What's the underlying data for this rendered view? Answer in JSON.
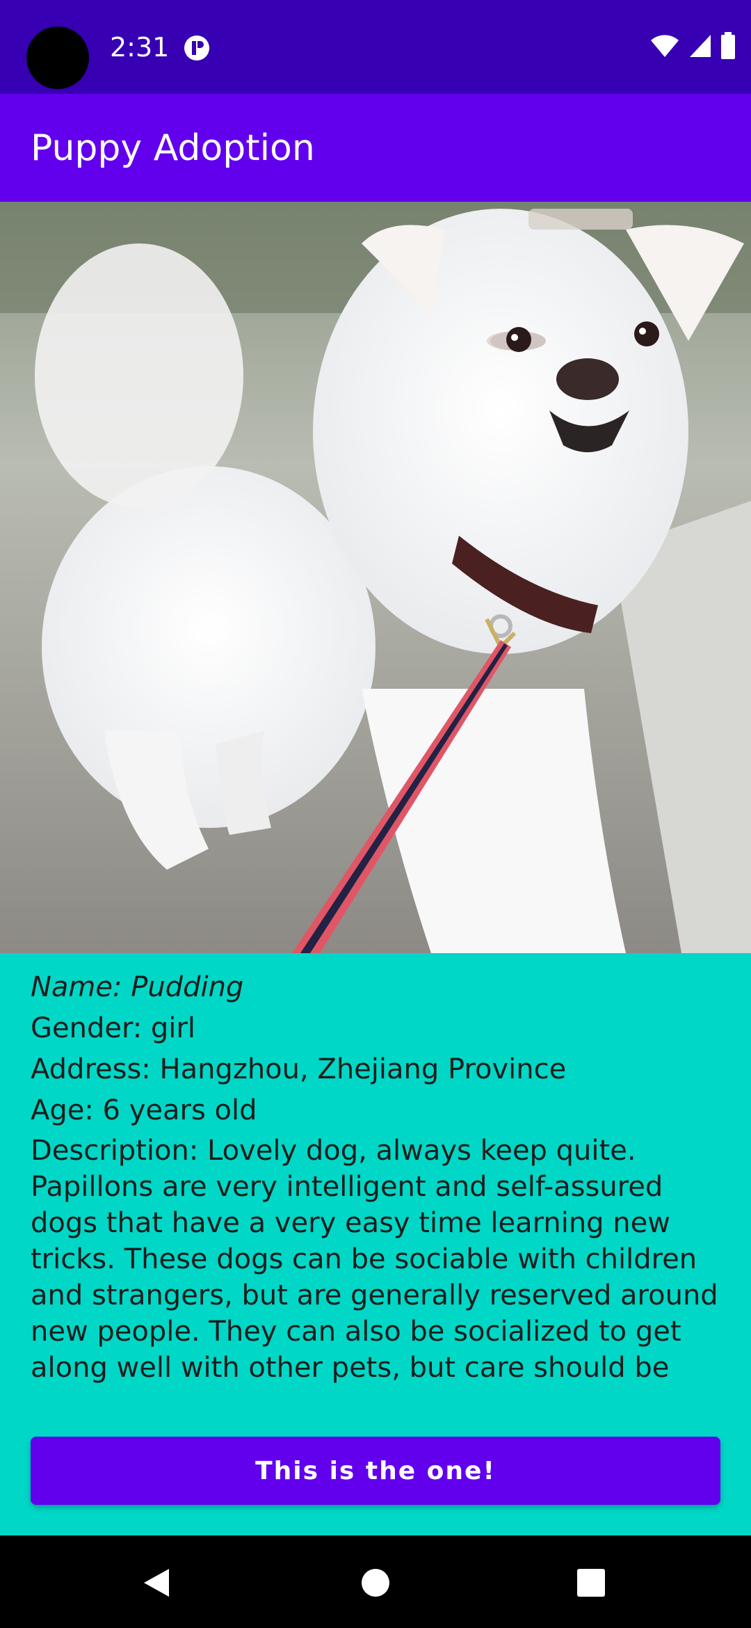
{
  "status_bar": {
    "time": "2:31",
    "icons": [
      "app-notification-icon",
      "wifi-icon",
      "cell-signal-icon",
      "battery-icon"
    ]
  },
  "app_bar": {
    "title": "Puppy Adoption"
  },
  "photo": {
    "subject": "dog-photo"
  },
  "details": {
    "name": "Name: Pudding",
    "gender": "Gender: girl",
    "address": "Address: Hangzhou, Zhejiang Province",
    "age": "Age: 6 years old",
    "description_lines": [
      "Description: Lovely dog, always keep quite.",
      "Papillons are very intelligent and self-assured",
      "dogs that have a very easy time learning new",
      "tricks. These dogs can be sociable with children",
      "and strangers, but are generally reserved around",
      "new people. They can also be socialized to get",
      "along well with other pets, but care should be"
    ]
  },
  "actions": {
    "adopt_label": "This is the one!"
  },
  "nav_bar": {
    "buttons": [
      "back-icon",
      "home-icon",
      "recents-icon"
    ]
  },
  "colors": {
    "status_bar": "#3700B3",
    "app_bar": "#6200EE",
    "background": "#00D7C6",
    "button": "#6200EE"
  }
}
